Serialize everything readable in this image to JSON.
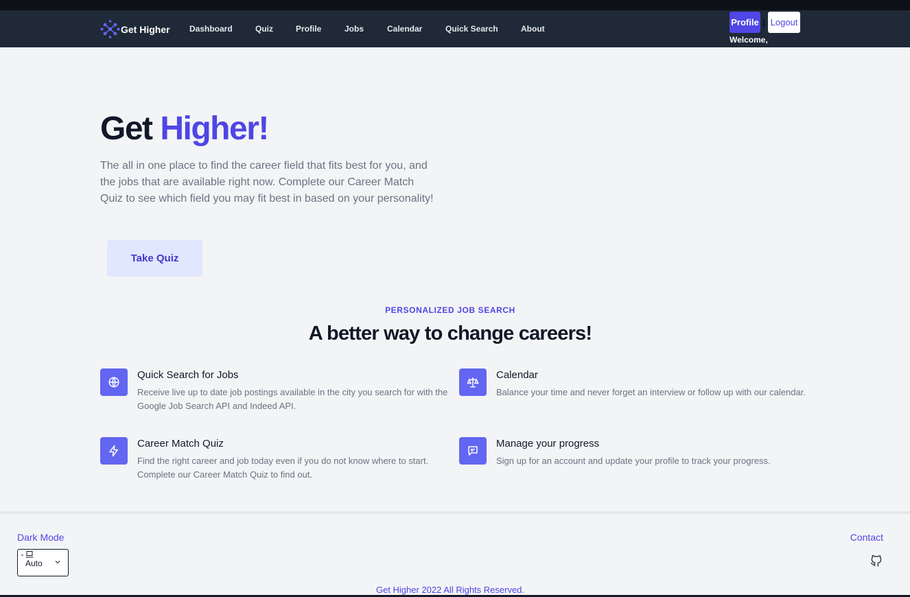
{
  "header": {
    "brand_name": "Get Higher",
    "nav_items": [
      {
        "label": "Dashboard"
      },
      {
        "label": "Quiz"
      },
      {
        "label": "Profile"
      },
      {
        "label": "Jobs"
      },
      {
        "label": "Calendar"
      },
      {
        "label": "Quick Search"
      },
      {
        "label": "About"
      }
    ],
    "profile_button": "Profile",
    "separator": "|",
    "logout_button": "Logout",
    "welcome": "Welcome,"
  },
  "hero": {
    "title_part1": "Get",
    "title_part2": "Higher!",
    "description": "The all in one place to find the career field that fits best for you, and the jobs that are available right now. Complete our Career Match Quiz to see which field you may fit best in based on your personality!",
    "cta": "Take Quiz"
  },
  "features_section": {
    "kicker": "PERSONALIZED JOB SEARCH",
    "title": "A better way to change careers!",
    "items": [
      {
        "title": "Quick Search for Jobs",
        "description": "Receive live up to date job postings available in the city you search for with the Google Job Search API and Indeed API.",
        "icon": "globe-icon"
      },
      {
        "title": "Calendar",
        "description": "Balance your time and never forget an interview or follow up with our calendar.",
        "icon": "scale-icon"
      },
      {
        "title": "Career Match Quiz",
        "description": "Find the right career and job today even if you do not know where to start. Complete our Career Match Quiz to find out.",
        "icon": "lightning-icon"
      },
      {
        "title": "Manage your progress",
        "description": "Sign up for an account and update your profile to track your progress.",
        "icon": "message-icon"
      }
    ]
  },
  "footer": {
    "dark_mode_label": "Dark Mode",
    "mode_value": "Auto",
    "contact": "Contact",
    "copyright": "Get Higher 2022 All Rights Reserved."
  },
  "colors": {
    "accent": "#4f46e5",
    "icon_bg": "#6366f1",
    "nav_bg": "#1f2937",
    "page_bg": "#f3f4f6",
    "quiz_button_bg": "#e0e7ff"
  }
}
